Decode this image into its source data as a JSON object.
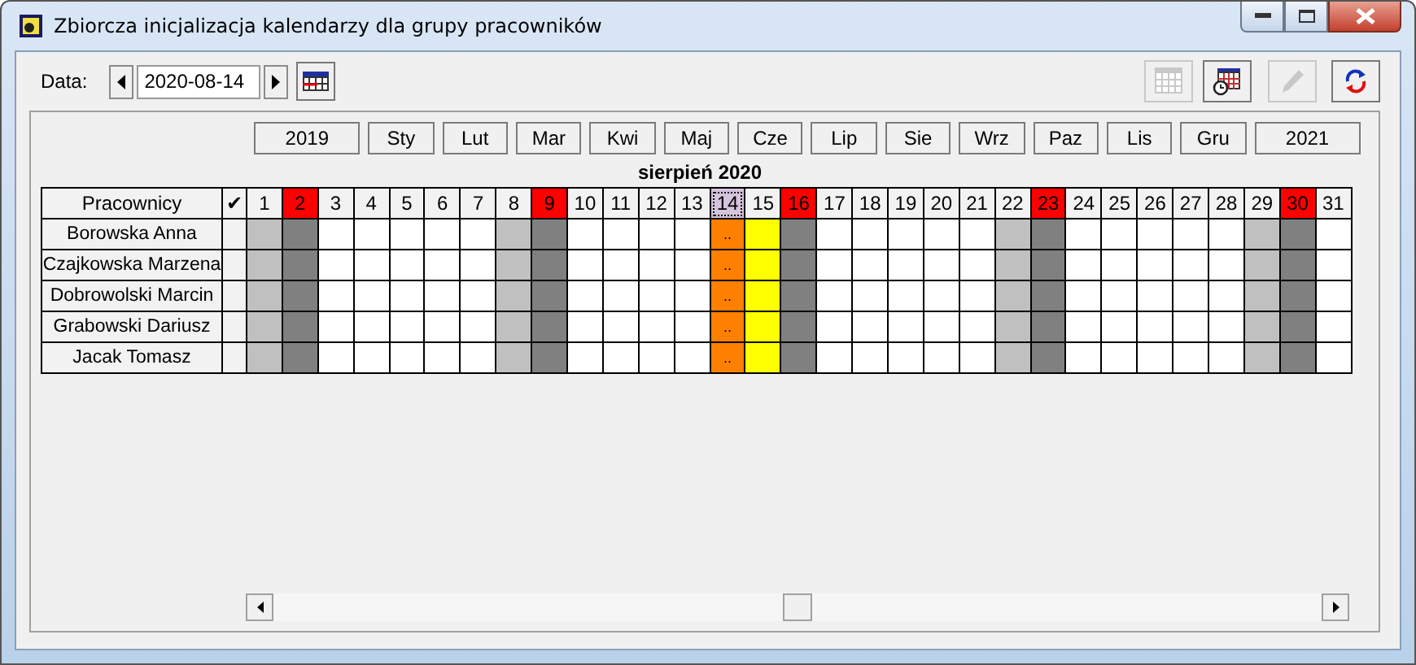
{
  "window": {
    "title": "Zbiorcza inicjalizacja kalendarzy dla grupy pracowników"
  },
  "date_bar": {
    "label": "Data:",
    "value": "2020-08-14"
  },
  "tool_buttons": [
    {
      "kind": "calendar",
      "disabled": true
    },
    {
      "kind": "calendar-clock",
      "disabled": false
    },
    {
      "kind": "pencil",
      "disabled": true
    },
    {
      "kind": "refresh",
      "disabled": false
    }
  ],
  "period_buttons": [
    {
      "label": "2019",
      "kind": "year"
    },
    {
      "label": "Sty",
      "kind": "month"
    },
    {
      "label": "Lut",
      "kind": "month"
    },
    {
      "label": "Mar",
      "kind": "month"
    },
    {
      "label": "Kwi",
      "kind": "month"
    },
    {
      "label": "Maj",
      "kind": "month"
    },
    {
      "label": "Cze",
      "kind": "month"
    },
    {
      "label": "Lip",
      "kind": "month"
    },
    {
      "label": "Sie",
      "kind": "month"
    },
    {
      "label": "Wrz",
      "kind": "month"
    },
    {
      "label": "Paz",
      "kind": "month"
    },
    {
      "label": "Lis",
      "kind": "month"
    },
    {
      "label": "Gru",
      "kind": "month"
    },
    {
      "label": "2021",
      "kind": "year"
    }
  ],
  "month_title": "sierpień 2020",
  "grid": {
    "name_header": "Pracownicy",
    "check_header": "✔",
    "days": [
      {
        "label": "1",
        "kind": "saturday",
        "selected": false
      },
      {
        "label": "2",
        "kind": "sunday",
        "selected": false
      },
      {
        "label": "3",
        "kind": "workday",
        "selected": false
      },
      {
        "label": "4",
        "kind": "workday",
        "selected": false
      },
      {
        "label": "5",
        "kind": "workday",
        "selected": false
      },
      {
        "label": "6",
        "kind": "workday",
        "selected": false
      },
      {
        "label": "7",
        "kind": "workday",
        "selected": false
      },
      {
        "label": "8",
        "kind": "saturday",
        "selected": false
      },
      {
        "label": "9",
        "kind": "sunday",
        "selected": false
      },
      {
        "label": "10",
        "kind": "workday",
        "selected": false
      },
      {
        "label": "11",
        "kind": "workday",
        "selected": false
      },
      {
        "label": "12",
        "kind": "workday",
        "selected": false
      },
      {
        "label": "13",
        "kind": "workday",
        "selected": false
      },
      {
        "label": "14",
        "kind": "current",
        "selected": true
      },
      {
        "label": "15",
        "kind": "holiday",
        "selected": false
      },
      {
        "label": "16",
        "kind": "sunday",
        "selected": false
      },
      {
        "label": "17",
        "kind": "workday",
        "selected": false
      },
      {
        "label": "18",
        "kind": "workday",
        "selected": false
      },
      {
        "label": "19",
        "kind": "workday",
        "selected": false
      },
      {
        "label": "20",
        "kind": "workday",
        "selected": false
      },
      {
        "label": "21",
        "kind": "workday",
        "selected": false
      },
      {
        "label": "22",
        "kind": "saturday",
        "selected": false
      },
      {
        "label": "23",
        "kind": "sunday",
        "selected": false
      },
      {
        "label": "24",
        "kind": "workday",
        "selected": false
      },
      {
        "label": "25",
        "kind": "workday",
        "selected": false
      },
      {
        "label": "26",
        "kind": "workday",
        "selected": false
      },
      {
        "label": "27",
        "kind": "workday",
        "selected": false
      },
      {
        "label": "28",
        "kind": "workday",
        "selected": false
      },
      {
        "label": "29",
        "kind": "saturday",
        "selected": false
      },
      {
        "label": "30",
        "kind": "sunday",
        "selected": false
      },
      {
        "label": "31",
        "kind": "workday",
        "selected": false
      }
    ],
    "rows": [
      {
        "name": "Borowska Anna",
        "current_text": ".."
      },
      {
        "name": "Czajkowska Marzena",
        "current_text": ".."
      },
      {
        "name": "Dobrowolski Marcin",
        "current_text": ".."
      },
      {
        "name": "Grabowski Dariusz",
        "current_text": ".."
      },
      {
        "name": "Jacak Tomasz",
        "current_text": ".."
      }
    ]
  }
}
